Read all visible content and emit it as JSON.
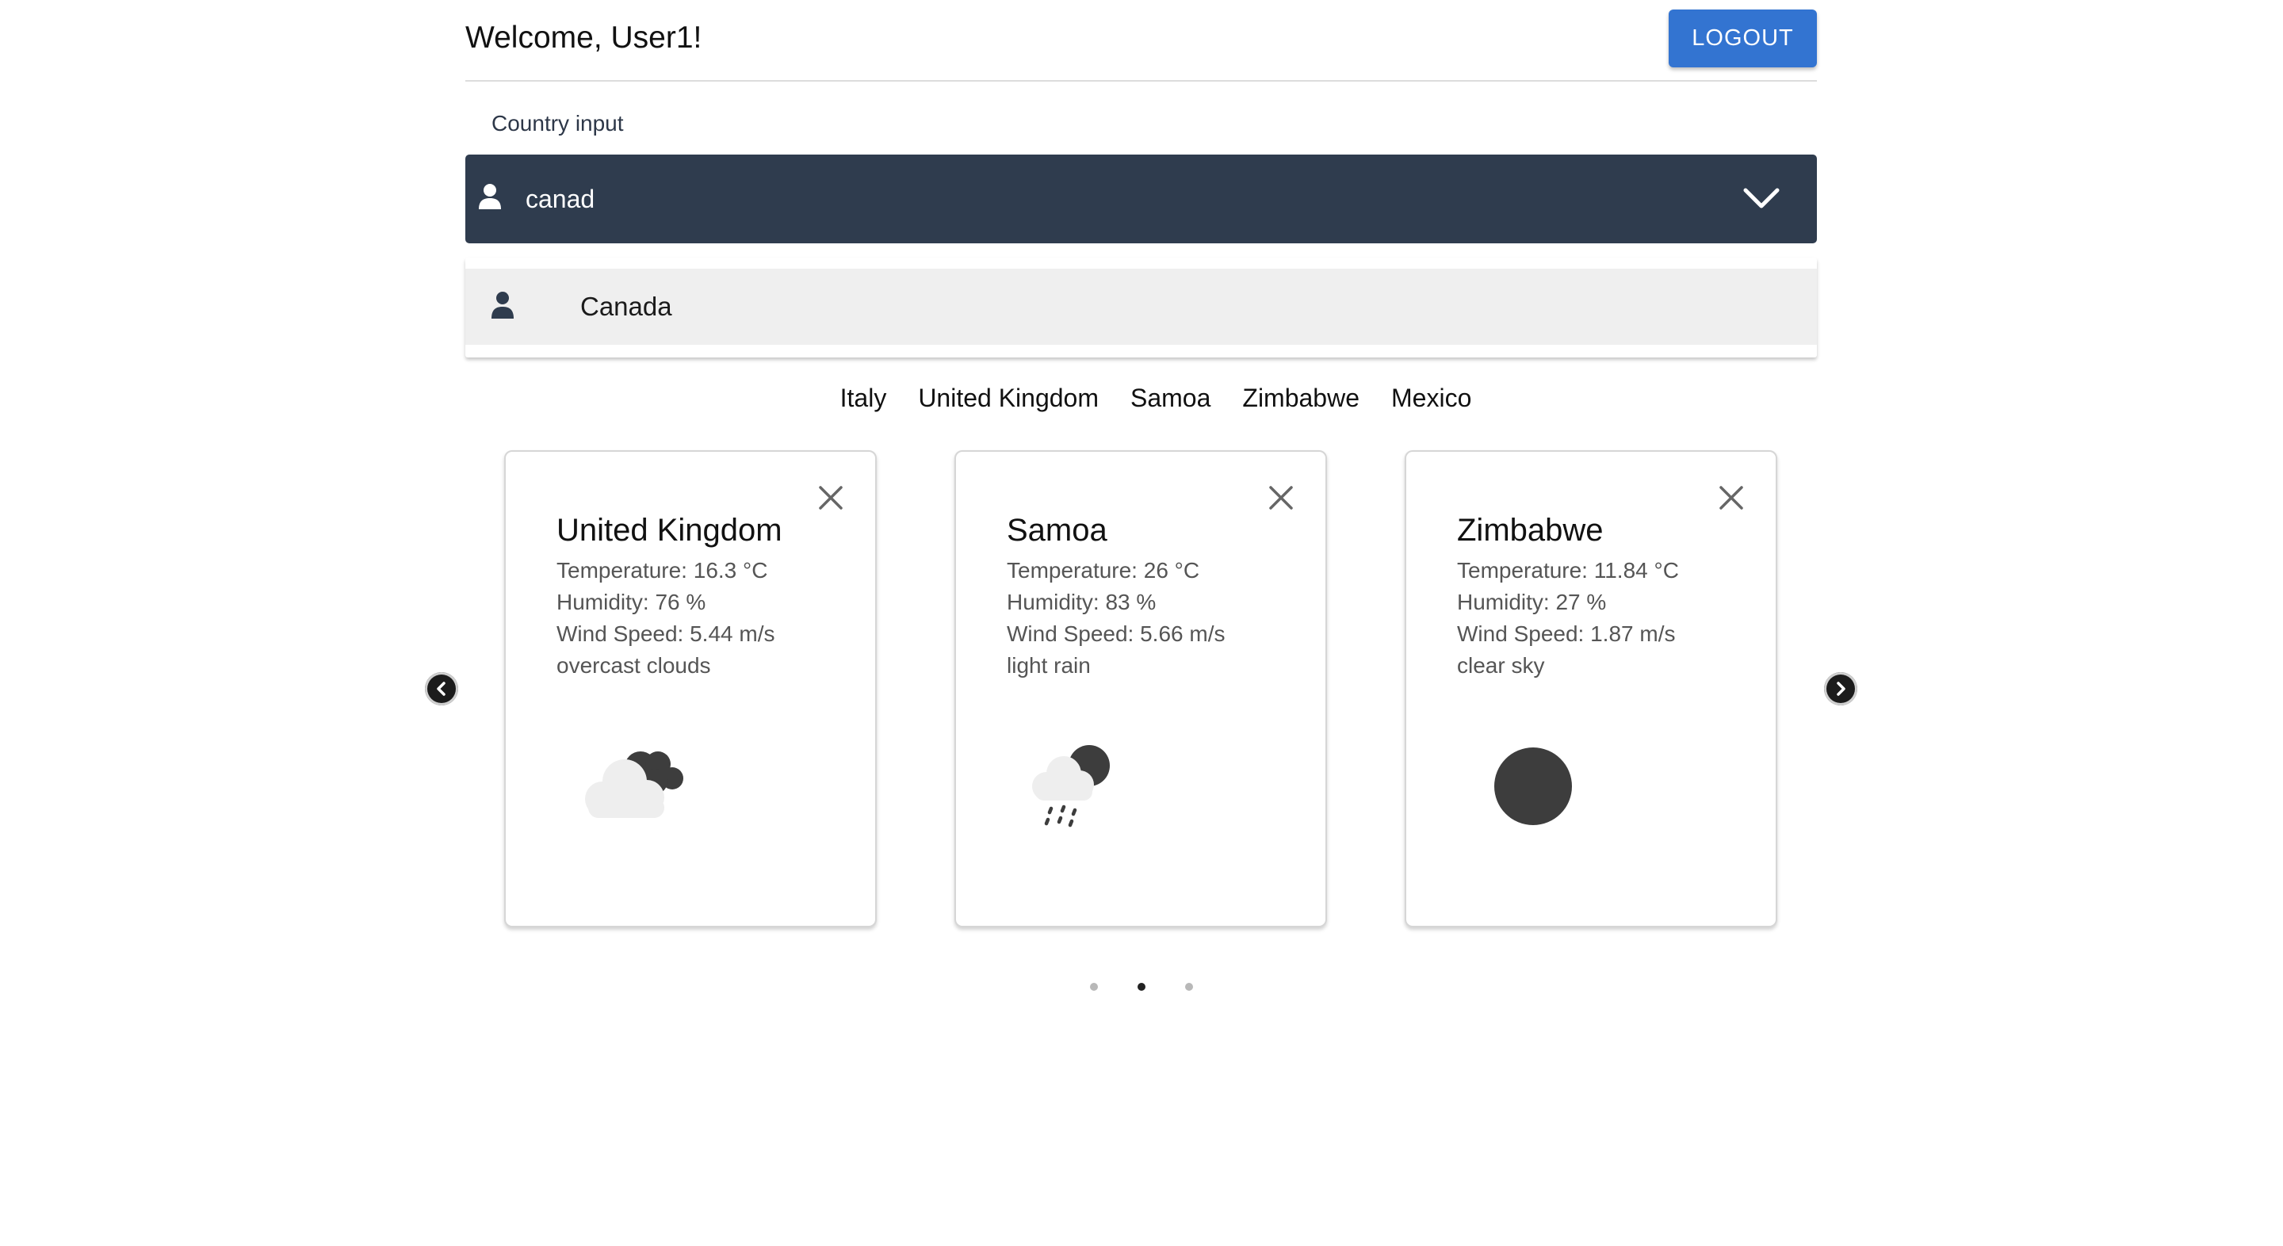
{
  "header": {
    "welcome_text": "Welcome, User1!",
    "logout_label": "LOGOUT"
  },
  "country_input": {
    "label": "Country input",
    "value": "canad",
    "icon": "person-icon",
    "toggle_icon": "chevron-down-icon"
  },
  "dropdown": {
    "options": [
      {
        "label": "Canada",
        "icon": "person-icon"
      }
    ]
  },
  "country_tabs": [
    "Italy",
    "United Kingdom",
    "Samoa",
    "Zimbabwe",
    "Mexico"
  ],
  "carousel": {
    "prev_icon": "chevron-left-icon",
    "next_icon": "chevron-right-icon",
    "cards": [
      {
        "country": "United Kingdom",
        "temperature": "Temperature: 16.3 °C",
        "humidity": "Humidity: 76 %",
        "wind_speed": "Wind Speed: 5.44 m/s",
        "description": "overcast clouds",
        "icon": "overcast-clouds-icon"
      },
      {
        "country": "Samoa",
        "temperature": "Temperature: 26 °C",
        "humidity": "Humidity: 83 %",
        "wind_speed": "Wind Speed: 5.66 m/s",
        "description": "light rain",
        "icon": "light-rain-icon"
      },
      {
        "country": "Zimbabwe",
        "temperature": "Temperature: 11.84 °C",
        "humidity": "Humidity: 27 %",
        "wind_speed": "Wind Speed: 1.87 m/s",
        "description": "clear sky",
        "icon": "clear-sky-icon"
      }
    ],
    "pages": 3,
    "active_page": 2
  },
  "colors": {
    "accent": "#3374d1",
    "input_bg": "#2f3c4e",
    "option_bg": "#efefef"
  }
}
